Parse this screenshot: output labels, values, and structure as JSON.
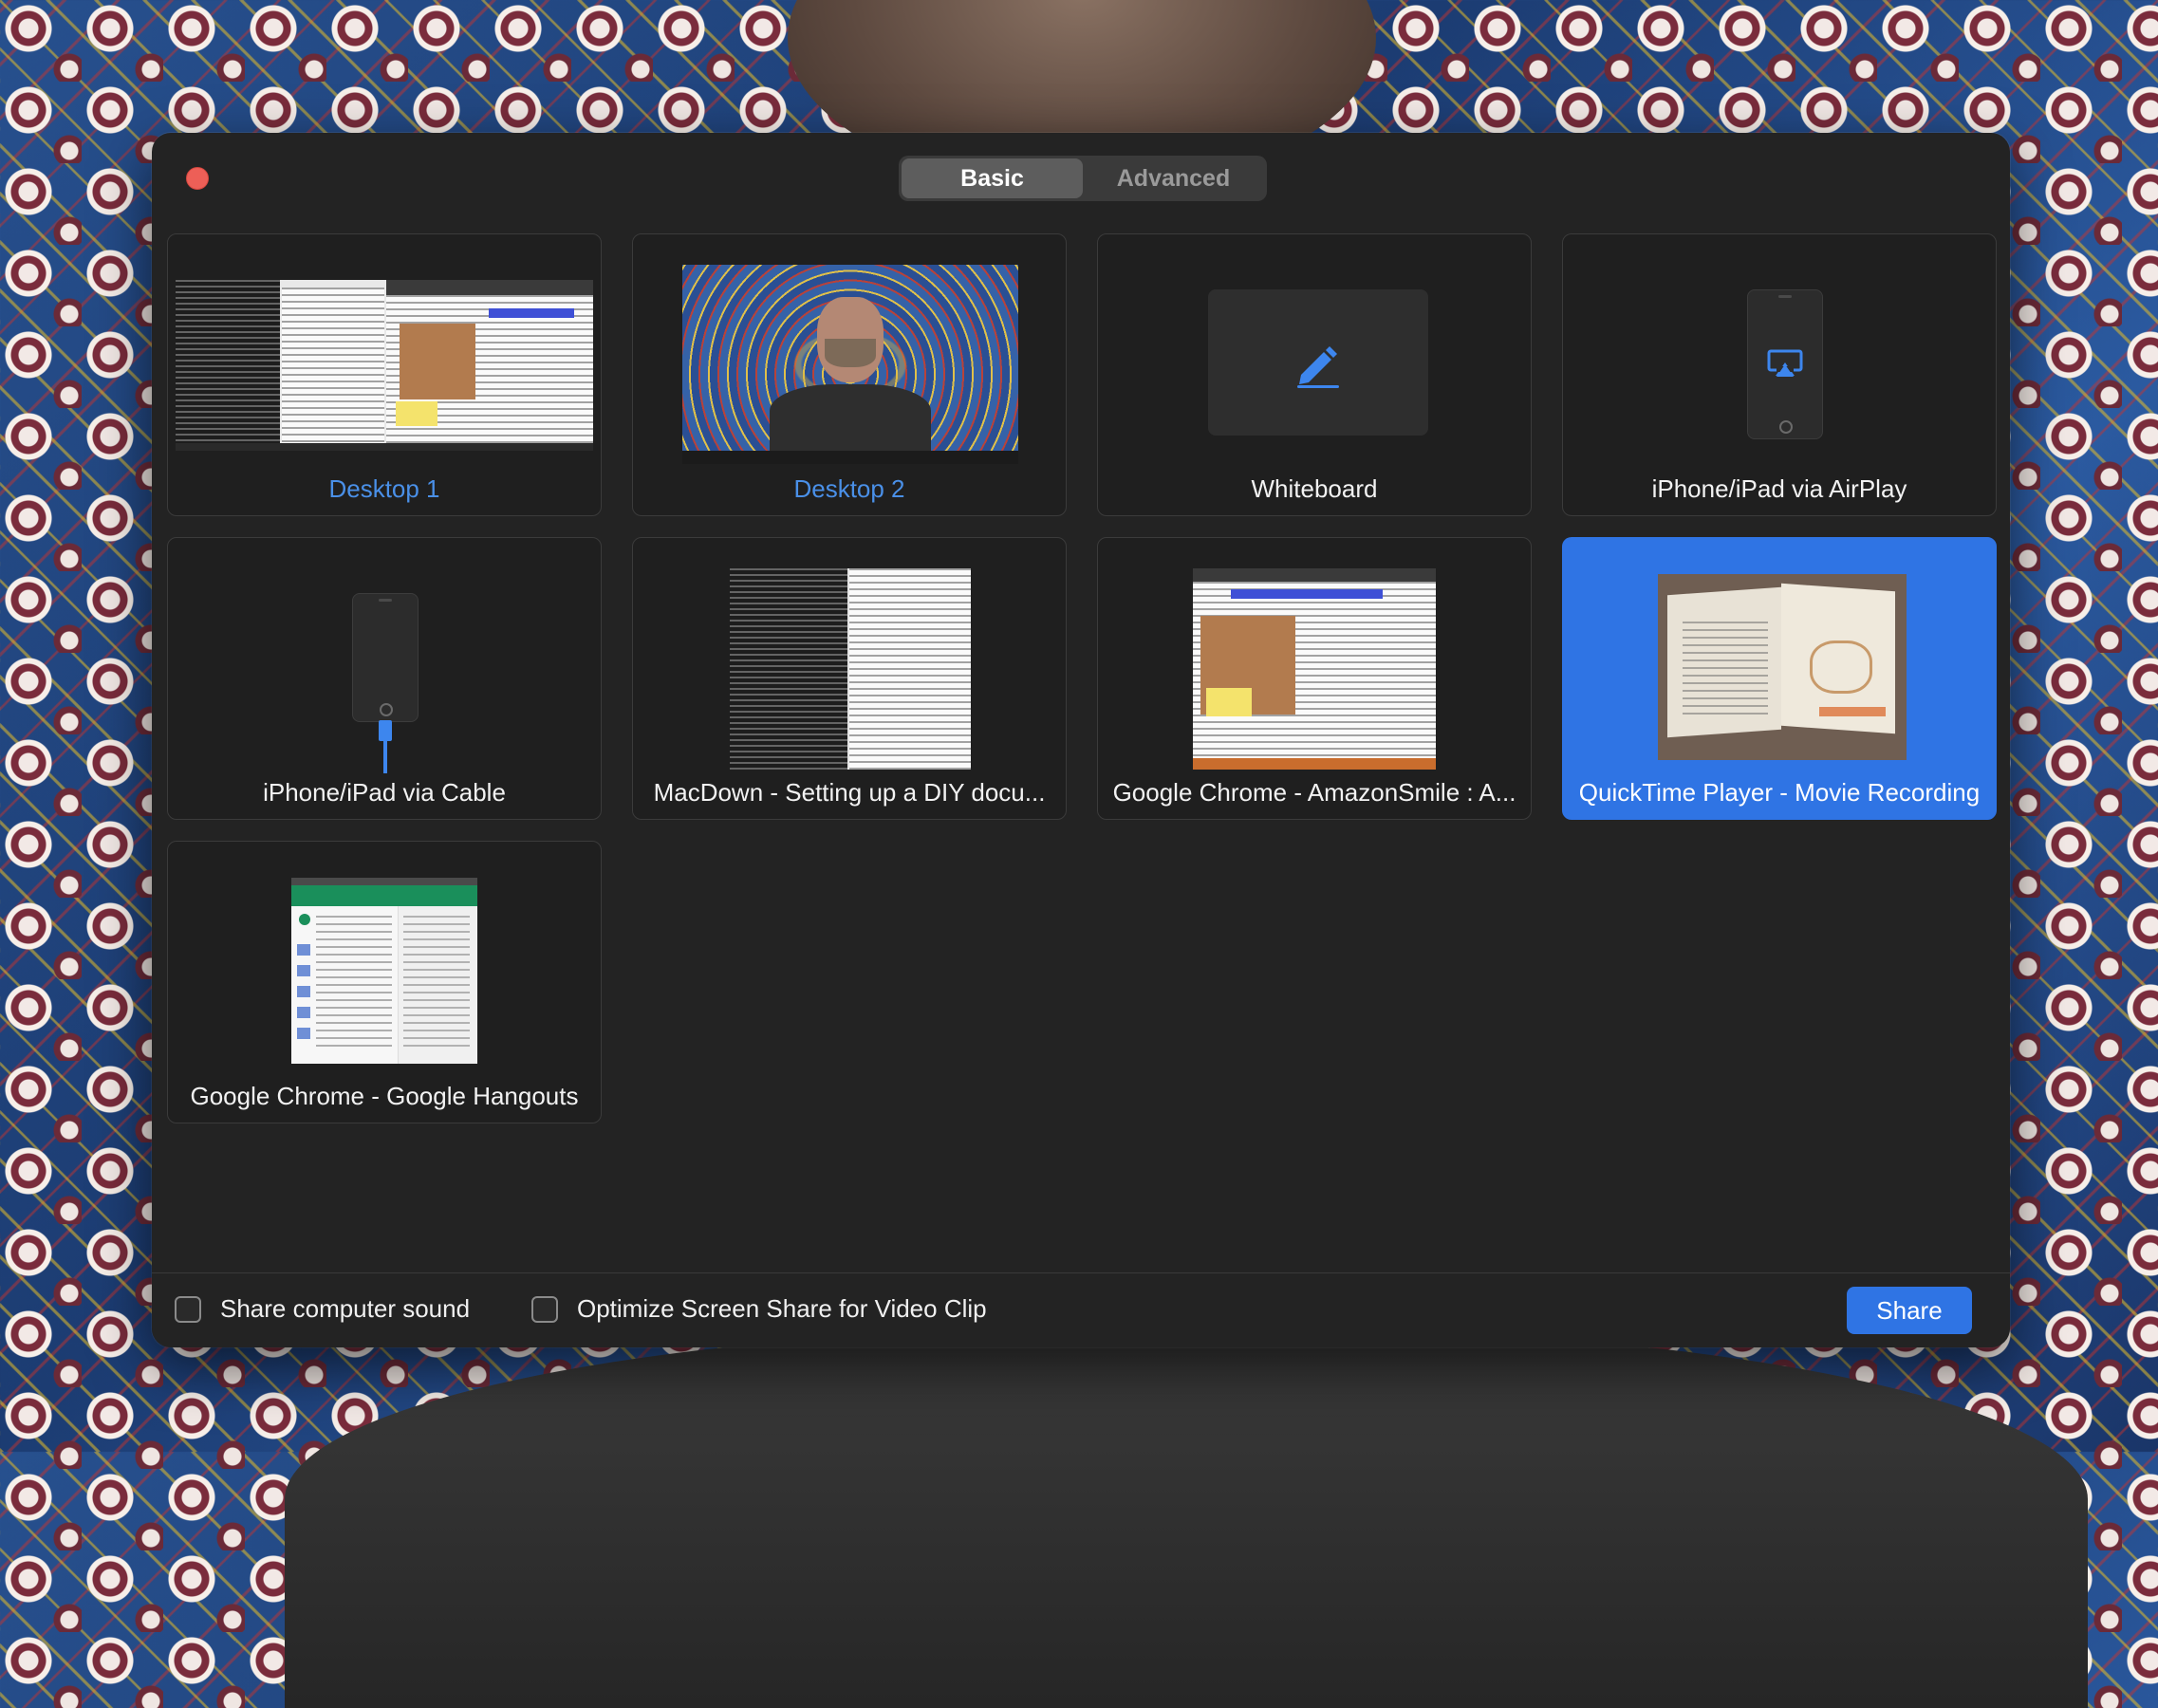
{
  "tabs": [
    {
      "label": "Basic",
      "active": true
    },
    {
      "label": "Advanced",
      "active": false
    }
  ],
  "tiles": [
    {
      "label": "Desktop 1",
      "kind": "desktop-screenshot",
      "label_color": "#4a90e8"
    },
    {
      "label": "Desktop 2",
      "kind": "webcam-desktop",
      "label_color": "#4a90e8"
    },
    {
      "label": "Whiteboard",
      "kind": "whiteboard",
      "icon": "pencil-icon"
    },
    {
      "label": "iPhone/iPad via AirPlay",
      "kind": "airplay",
      "icon": "airplay-icon"
    },
    {
      "label": "iPhone/iPad via Cable",
      "kind": "cable",
      "icon": "lightning-cable-icon"
    },
    {
      "label": "MacDown - Setting up a DIY docu...",
      "kind": "window"
    },
    {
      "label": "Google Chrome - AmazonSmile : A...",
      "kind": "window"
    },
    {
      "label": "QuickTime Player - Movie Recording",
      "kind": "window",
      "selected": true
    },
    {
      "label": "Google Chrome - Google Hangouts",
      "kind": "window"
    }
  ],
  "options": {
    "share_sound": {
      "label": "Share computer sound",
      "checked": false
    },
    "optimize_video": {
      "label": "Optimize Screen Share for Video Clip",
      "checked": false
    }
  },
  "share_button": {
    "label": "Share"
  },
  "colors": {
    "accent": "#2f74e4",
    "window_bg": "#232323",
    "close": "#ed5f57"
  }
}
